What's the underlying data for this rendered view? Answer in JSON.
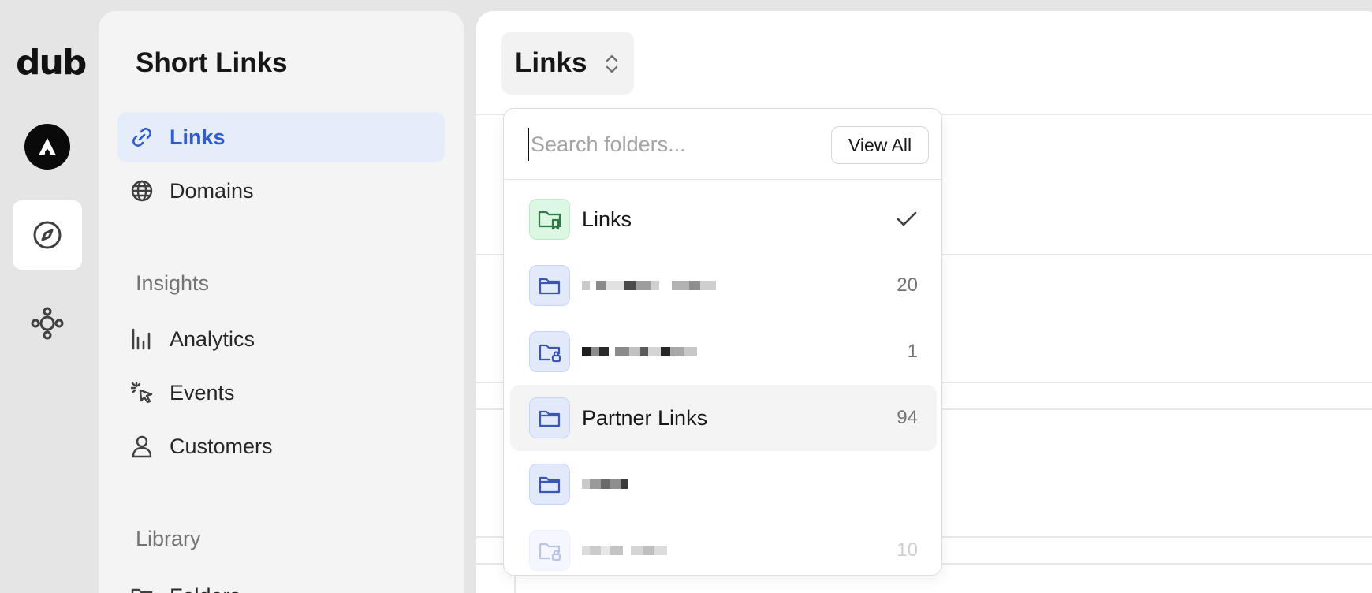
{
  "rail": {
    "logo": "dub",
    "items": [
      {
        "icon": "workspace-avatar-icon"
      },
      {
        "icon": "compass-icon",
        "active": true
      },
      {
        "icon": "network-icon"
      }
    ]
  },
  "sidebar": {
    "title": "Short Links",
    "nav": [
      {
        "label": "Links",
        "icon": "link-icon",
        "active": true
      },
      {
        "label": "Domains",
        "icon": "globe-icon"
      }
    ],
    "insights_title": "Insights",
    "insights": [
      {
        "label": "Analytics",
        "icon": "bar-chart-icon"
      },
      {
        "label": "Events",
        "icon": "cursor-click-icon"
      },
      {
        "label": "Customers",
        "icon": "user-icon"
      }
    ],
    "library_title": "Library",
    "library": [
      {
        "label": "Folders",
        "icon": "folder-icon"
      }
    ]
  },
  "main": {
    "switcher_label": "Links"
  },
  "dropdown": {
    "search_placeholder": "Search folders...",
    "view_all_label": "View All",
    "folders": [
      {
        "name": "Links",
        "count": "",
        "selected": true,
        "icon": "folder-bookmark-icon",
        "color": "green"
      },
      {
        "name": "",
        "count": "20",
        "icon": "folder-icon",
        "color": "blue",
        "redacted": true
      },
      {
        "name": "",
        "count": "1",
        "icon": "folder-lock-icon",
        "color": "blue",
        "redacted": true
      },
      {
        "name": "Partner Links",
        "count": "94",
        "icon": "folder-icon",
        "color": "blue",
        "hovered": true
      },
      {
        "name": "",
        "count": "",
        "icon": "folder-icon",
        "color": "blue",
        "redacted": true
      },
      {
        "name": "",
        "count": "10",
        "icon": "folder-lock-icon",
        "color": "blue",
        "redacted": true,
        "faded": true
      }
    ]
  },
  "colors": {
    "accent": "#2f5ccf",
    "active_bg": "#e6edfa",
    "folder_green": "#dcf7e3",
    "folder_blue": "#e1e9fb"
  }
}
